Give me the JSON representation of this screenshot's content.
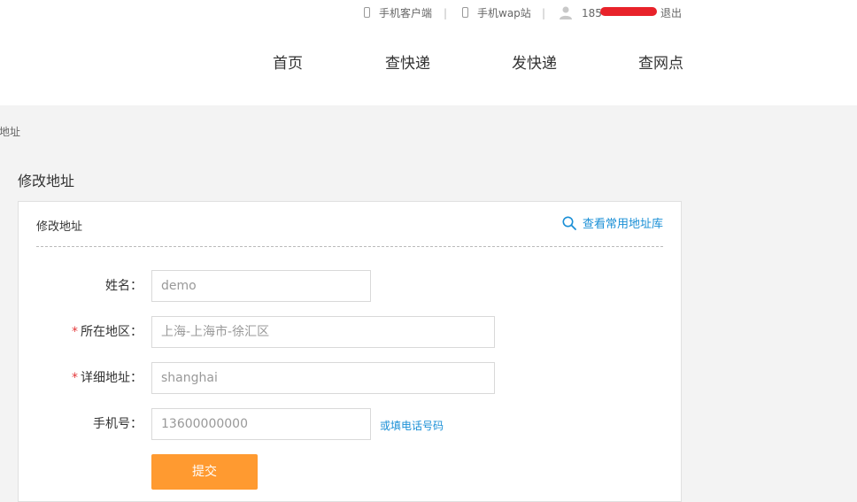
{
  "topbar": {
    "client_label": "手机客户端",
    "wap_label": "手机wap站",
    "separator": "|",
    "phone_partial": "185",
    "logout_label": "退出"
  },
  "nav": [
    "首页",
    "查快递",
    "发快递",
    "查网点"
  ],
  "breadcrumb": "改地址",
  "page_title": "修改地址",
  "card": {
    "title": "修改地址",
    "address_book_link": "查看常用地址库"
  },
  "form": {
    "name": {
      "label": "姓名：",
      "value": "demo"
    },
    "region": {
      "label": "所在地区：",
      "required_mark": "*",
      "value": "上海-上海市-徐汇区"
    },
    "detail": {
      "label": "详细地址：",
      "required_mark": "*",
      "value": "shanghai"
    },
    "phone": {
      "label": "手机号：",
      "value": "13600000000",
      "alt_hint": "或填电话号码"
    },
    "submit_label": "提交"
  },
  "colors": {
    "accent_link": "#1a8fd6",
    "submit_orange": "#ff9a30",
    "required_red": "#e4393c",
    "redaction_red": "#e8222a"
  },
  "icons": [
    "phone-icon",
    "user-icon",
    "search-icon"
  ]
}
